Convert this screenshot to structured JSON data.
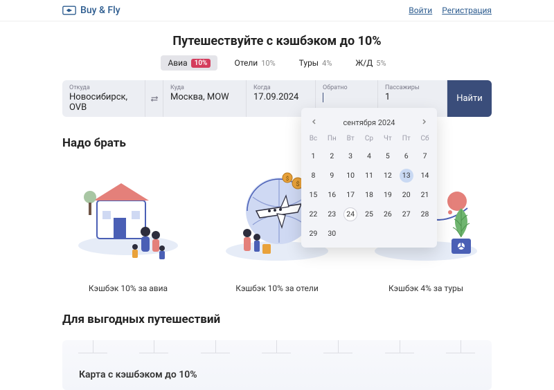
{
  "header": {
    "brand": "Buy & Fly",
    "login": "Войти",
    "register": "Регистрация"
  },
  "hero": {
    "title": "Путешествуйте с кэшбэком до 10%"
  },
  "tabs": [
    {
      "label": "Авиа",
      "badge": "10%",
      "active": true
    },
    {
      "label": "Отели",
      "pct": "10%",
      "active": false
    },
    {
      "label": "Туры",
      "pct": "4%",
      "active": false
    },
    {
      "label": "Ж/Д",
      "pct": "5%",
      "active": false
    }
  ],
  "search": {
    "from_label": "Откуда",
    "from_value": "Новосибирск, OVB",
    "to_label": "Куда",
    "to_value": "Москва, MOW",
    "when_label": "Когда",
    "when_value": "17.09.2024",
    "return_label": "Обратно",
    "return_value": "",
    "passengers_label": "Пассажиры",
    "passengers_value": "1",
    "find": "Найти"
  },
  "calendar": {
    "month": "сентября 2024",
    "dow": [
      "Вс",
      "Пн",
      "Вт",
      "Ср",
      "Чт",
      "Пт",
      "Сб"
    ],
    "today": 13,
    "selected": 24,
    "first_day_col": 0,
    "days_in_month": 30
  },
  "sections": {
    "must_take": "Надо брать",
    "deals": "Для выгодных путешествий"
  },
  "cards": [
    {
      "caption": "Кэшбэк 10% за авиа"
    },
    {
      "caption": "Кэшбэк 10% за отели"
    },
    {
      "caption": "Кэшбэк 4% за туры"
    }
  ],
  "banner": {
    "title": "Карта с кэшбэком до 10%"
  }
}
